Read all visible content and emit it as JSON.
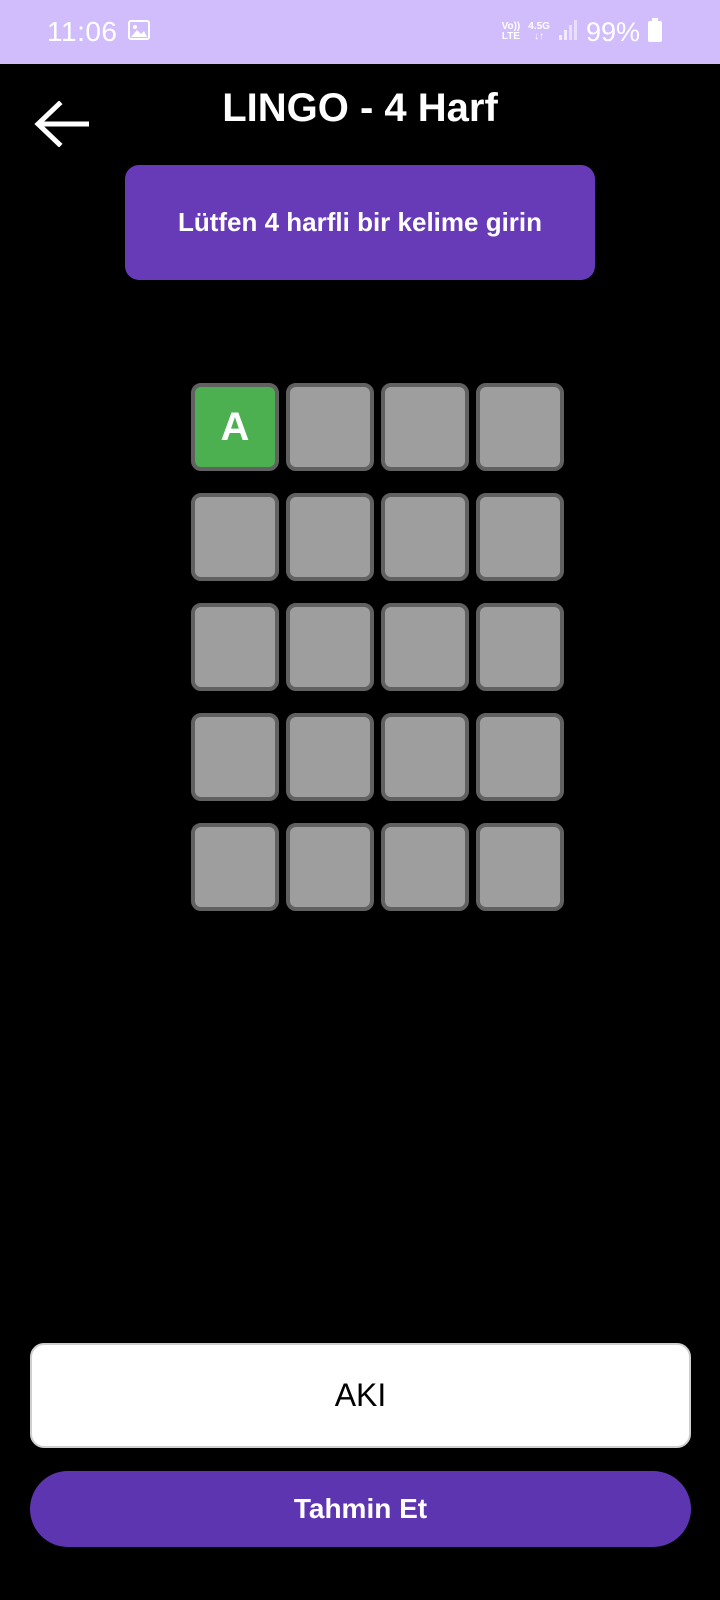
{
  "status_bar": {
    "time": "11:06",
    "network_top": "Vo))",
    "network_bottom": "LTE",
    "network_type": "4.5G",
    "battery": "99%",
    "icons": [
      "image-icon",
      "signal-icon",
      "battery-icon"
    ]
  },
  "header": {
    "title": "LINGO - 4 Harf",
    "back_icon": "arrow-left-icon"
  },
  "message": {
    "text": "Lütfen 4 harfli bir kelime girin"
  },
  "grid": {
    "rows": [
      [
        {
          "letter": "A",
          "state": "correct"
        },
        {
          "letter": "",
          "state": "empty"
        },
        {
          "letter": "",
          "state": "empty"
        },
        {
          "letter": "",
          "state": "empty"
        }
      ],
      [
        {
          "letter": "",
          "state": "empty"
        },
        {
          "letter": "",
          "state": "empty"
        },
        {
          "letter": "",
          "state": "empty"
        },
        {
          "letter": "",
          "state": "empty"
        }
      ],
      [
        {
          "letter": "",
          "state": "empty"
        },
        {
          "letter": "",
          "state": "empty"
        },
        {
          "letter": "",
          "state": "empty"
        },
        {
          "letter": "",
          "state": "empty"
        }
      ],
      [
        {
          "letter": "",
          "state": "empty"
        },
        {
          "letter": "",
          "state": "empty"
        },
        {
          "letter": "",
          "state": "empty"
        },
        {
          "letter": "",
          "state": "empty"
        }
      ],
      [
        {
          "letter": "",
          "state": "empty"
        },
        {
          "letter": "",
          "state": "empty"
        },
        {
          "letter": "",
          "state": "empty"
        },
        {
          "letter": "",
          "state": "empty"
        }
      ]
    ]
  },
  "input": {
    "value": "AKI"
  },
  "submit": {
    "label": "Tahmin Et"
  },
  "colors": {
    "status_bar": "#d1bdfc",
    "background": "#000000",
    "accent": "#673ab7",
    "correct": "#4caf50",
    "empty_cell": "#9e9e9e"
  }
}
